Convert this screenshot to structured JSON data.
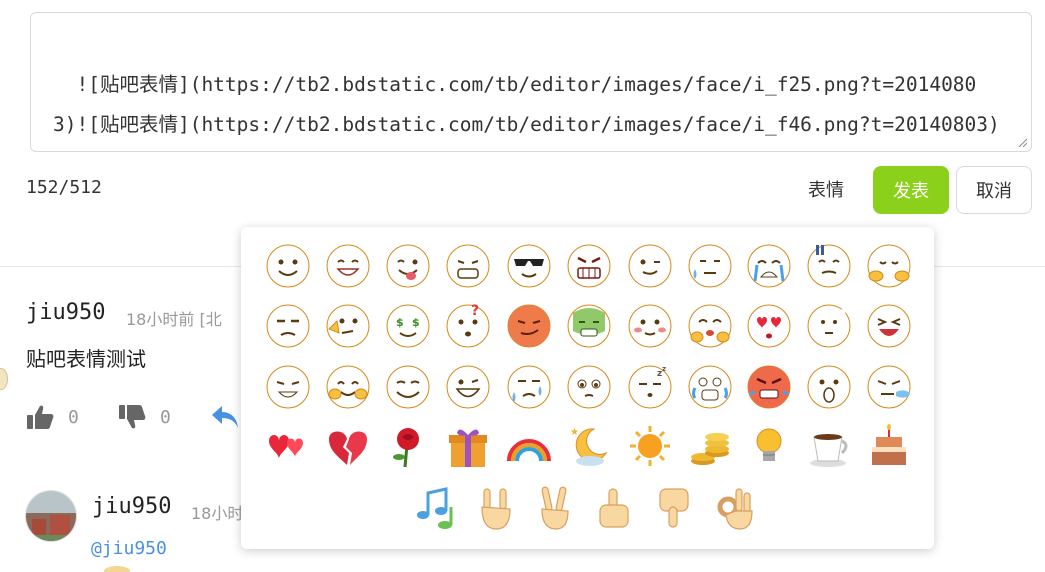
{
  "editor": {
    "text": "![贴吧表情](https://tb2.bdstatic.com/tb/editor/images/face/i_f25.png?t=20140803)![贴吧表情](https://tb2.bdstatic.com/tb/editor/images/face/i_f46.png?t=20140803)",
    "char_count": "152/512"
  },
  "toolbar": {
    "emoji_label": "表情",
    "submit_label": "发表",
    "cancel_label": "取消"
  },
  "comment": {
    "username": "jiu950",
    "time": "18小时前 [北",
    "text": "贴吧表情测试",
    "likes": "0",
    "dislikes": "0"
  },
  "reply": {
    "username": "jiu950",
    "time": "18小时",
    "mention": "@jiu950"
  },
  "emoji_panel": {
    "rows": [
      [
        "smile",
        "grin",
        "tongue-out",
        "grimace",
        "cool-sunglasses",
        "angry",
        "wink",
        "sweat",
        "crying",
        "embarrassed",
        "hug"
      ],
      [
        "unamused",
        "thinking",
        "money-eyes",
        "confused",
        "smirk",
        "sick",
        "blushing",
        "pouting",
        "heart-eyes",
        "shy",
        "laughing"
      ],
      [
        "eyes-closed",
        "blush-laugh",
        "content",
        "big-grin",
        "cold-sweat",
        "teary",
        "sleepy",
        "scared",
        "furious",
        "shocked",
        "sneeze"
      ],
      [
        "hearts",
        "broken-heart",
        "rose",
        "gift",
        "rainbow",
        "moon",
        "sun",
        "coins",
        "bulb",
        "coffee",
        "cake"
      ],
      [
        "music",
        "rock-on",
        "victory",
        "thumbs-up",
        "thumbs-down",
        "ok-hand"
      ]
    ]
  }
}
